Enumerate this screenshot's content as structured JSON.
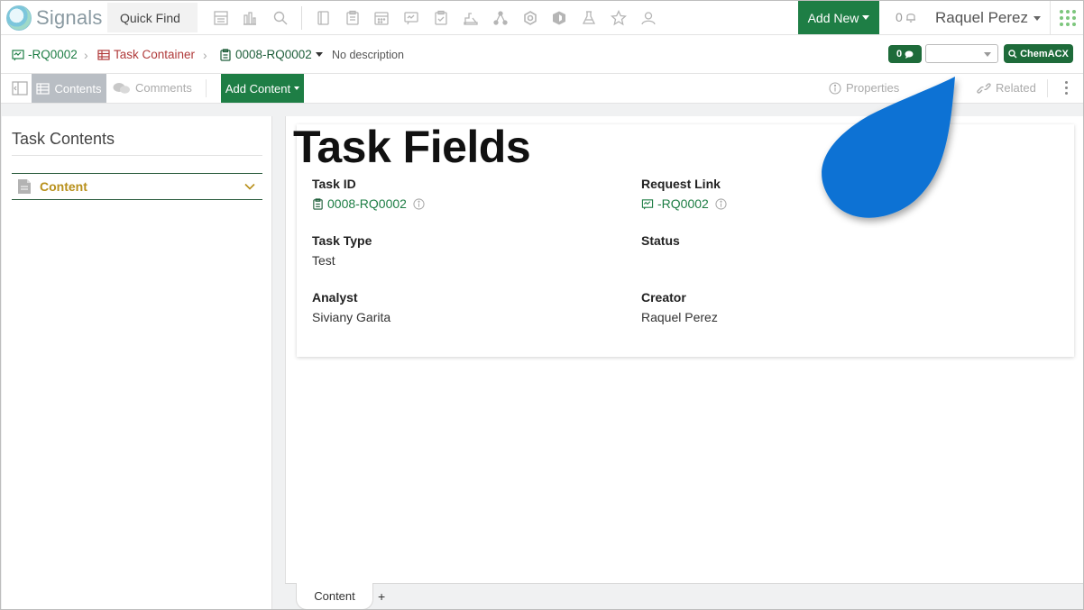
{
  "topbar": {
    "app_name": "Signals",
    "quick_find_label": "Quick Find",
    "add_new_label": "Add New",
    "notification_count": "0",
    "user_name": "Raquel Perez"
  },
  "breadcrumb": {
    "request_label": "-RQ0002",
    "container_label": "Task Container",
    "task_label": "0008-RQ0002",
    "description": "No description",
    "comment_count": "0",
    "select_value": "",
    "chemacx_label": "ChemACX",
    "colors": {
      "link_green": "#1e7e45",
      "container_red": "#b03a3a"
    }
  },
  "toolbar": {
    "contents_label": "Contents",
    "comments_label": "Comments",
    "add_content_label": "Add Content",
    "properties_label": "Properties",
    "related_label": "Related"
  },
  "left_pane": {
    "title": "Task Contents",
    "items": [
      {
        "label": "Content",
        "icon": "document-icon"
      }
    ]
  },
  "card": {
    "title": "Task Fields",
    "fields": {
      "task_id": {
        "label": "Task ID",
        "value": "0008-RQ0002"
      },
      "request_link": {
        "label": "Request Link",
        "value": "-RQ0002"
      },
      "task_type": {
        "label": "Task Type",
        "value": "Test"
      },
      "status": {
        "label": "Status",
        "value": ""
      },
      "analyst": {
        "label": "Analyst",
        "value": "Siviany Garita"
      },
      "creator": {
        "label": "Creator",
        "value": "Raquel Perez"
      }
    }
  },
  "bottom_tabs": {
    "tabs": [
      {
        "label": "Content"
      }
    ],
    "add_label": "+"
  },
  "overlay": {
    "shape": "droplet",
    "color": "#0a72d4"
  }
}
